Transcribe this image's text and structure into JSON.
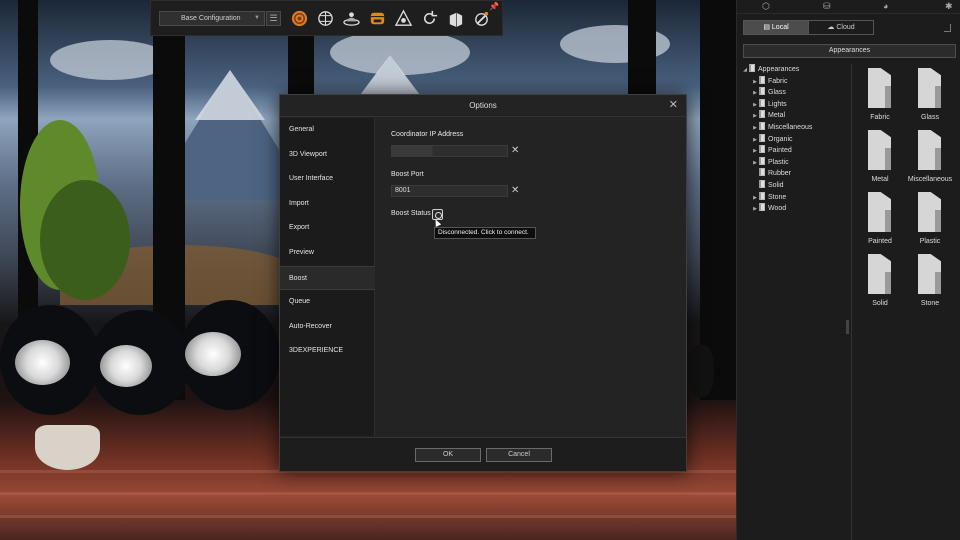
{
  "toolbar": {
    "config_value": "Base Configuration",
    "icons": [
      "render-icon",
      "materials-icon",
      "environment-icon",
      "lighting-icon",
      "camera-icon",
      "refresh-icon",
      "geometry-icon",
      "tools-icon",
      "pin-icon"
    ]
  },
  "dialog": {
    "title": "Options",
    "nav": [
      "General",
      "3D Viewport",
      "User Interface",
      "Import",
      "Export",
      "Preview",
      "Boost",
      "Queue",
      "Auto-Recover",
      "3DEXPERIENCE"
    ],
    "selected_nav": "Boost",
    "coordinator_label": "Coordinator IP Address",
    "coordinator_value": "",
    "boost_port_label": "Boost Port",
    "boost_port_value": "8001",
    "boost_status_label": "Boost Status",
    "tooltip": "Disconnected. Click to connect.",
    "ok": "OK",
    "cancel": "Cancel"
  },
  "library": {
    "local_tab": "Local",
    "cloud_tab": "Cloud",
    "appearances_button": "Appearances",
    "tree_root": "Appearances",
    "tree": [
      {
        "label": "Fabric",
        "expandable": true
      },
      {
        "label": "Glass",
        "expandable": true
      },
      {
        "label": "Lights",
        "expandable": true
      },
      {
        "label": "Metal",
        "expandable": true
      },
      {
        "label": "Miscellaneous",
        "expandable": true
      },
      {
        "label": "Organic",
        "expandable": true
      },
      {
        "label": "Painted",
        "expandable": true
      },
      {
        "label": "Plastic",
        "expandable": true
      },
      {
        "label": "Rubber",
        "expandable": false
      },
      {
        "label": "Solid",
        "expandable": false
      },
      {
        "label": "Stone",
        "expandable": true
      },
      {
        "label": "Wood",
        "expandable": true
      }
    ],
    "thumbnails": [
      "Fabric",
      "Glass",
      "Metal",
      "Miscellaneous",
      "Painted",
      "Plastic",
      "Solid",
      "Stone"
    ]
  },
  "colors": {
    "panel_bg": "#1c1c1c",
    "dialog_bg": "#232323",
    "accent": "#f0a020"
  }
}
